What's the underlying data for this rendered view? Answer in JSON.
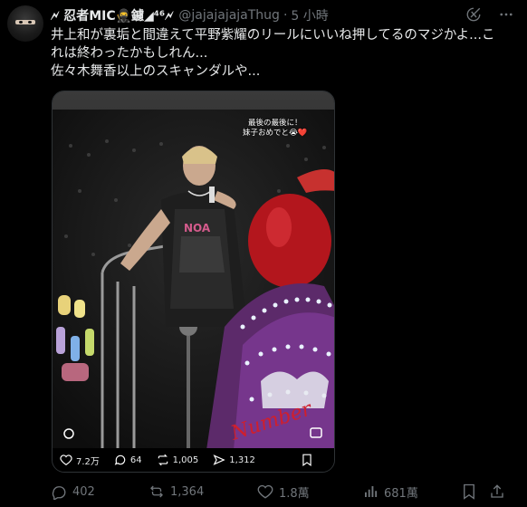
{
  "author": {
    "display_name": "🗲 忍者MIC🥷鑢◢⁴⁶🗲",
    "handle": "@jajajajajaThug",
    "time": "5 小時"
  },
  "tweet": {
    "lines": [
      "井上和が裏垢と間違えて平野紫耀のリールにいいね押してるのマジかよ...こ",
      "れは終わったかもしれん...",
      "佐々木舞香以上のスキャンダルや..."
    ]
  },
  "media": {
    "caption_line1": "最後の最後に！",
    "caption_line2": "妹子おめでと😭❤️",
    "stats": {
      "likes": "7.2万",
      "comments": "64",
      "reposts": "1,005",
      "shares": "1,312"
    }
  },
  "actions": {
    "replies": "402",
    "reposts": "1,364",
    "likes": "1.8萬",
    "views": "681萬"
  },
  "icons": {
    "grok": "grok-icon",
    "more": "more-icon",
    "reply": "reply-icon",
    "repost": "repost-icon",
    "like": "heart-icon",
    "views": "views-icon",
    "bookmark": "bookmark-icon",
    "share": "share-icon"
  }
}
